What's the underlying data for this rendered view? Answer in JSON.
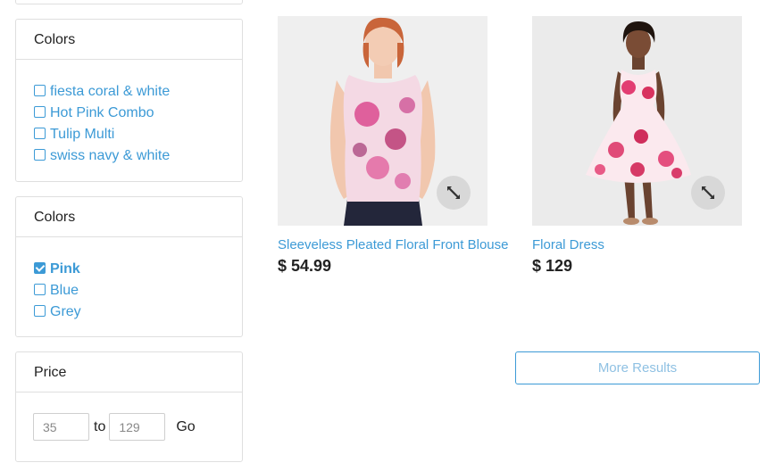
{
  "filters": {
    "colors_1": {
      "title": "Colors",
      "options": [
        "fiesta coral & white",
        "Hot Pink Combo",
        "Tulip Multi",
        "swiss navy & white"
      ]
    },
    "colors_2": {
      "title": "Colors",
      "options": [
        {
          "label": "Pink",
          "checked": true
        },
        {
          "label": "Blue",
          "checked": false
        },
        {
          "label": "Grey",
          "checked": false
        }
      ]
    },
    "price": {
      "title": "Price",
      "min_value": "35",
      "to_label": "to",
      "max_value": "129",
      "go_label": "Go"
    }
  },
  "products": [
    {
      "name": "Sleeveless Pleated Floral Front Blouse",
      "price": "$ 54.99"
    },
    {
      "name": "Floral Dress",
      "price": "$ 129"
    }
  ],
  "more_results_label": "More Results",
  "colors": {
    "link": "#3c9ad6",
    "border": "#dfdfdf"
  }
}
